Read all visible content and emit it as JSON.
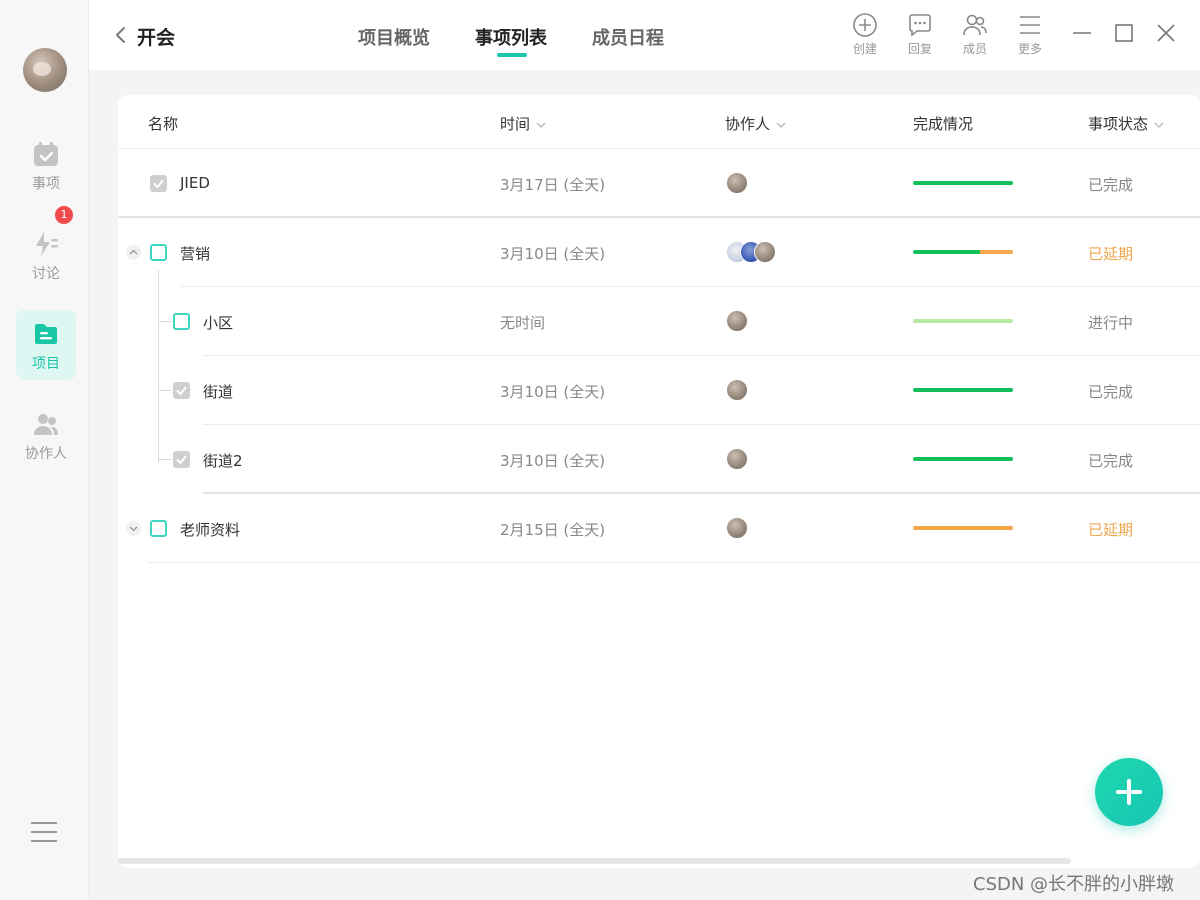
{
  "sidebar": {
    "items": [
      {
        "label": "事项",
        "icon": "calendar-check-icon"
      },
      {
        "label": "讨论",
        "icon": "lightning-icon",
        "badge": "1"
      },
      {
        "label": "项目",
        "icon": "folder-icon",
        "active": true
      },
      {
        "label": "协作人",
        "icon": "people-icon"
      }
    ],
    "menu_icon": "hamburger-menu-icon"
  },
  "header": {
    "title": "开会",
    "tabs": [
      {
        "label": "项目概览"
      },
      {
        "label": "事项列表",
        "active": true
      },
      {
        "label": "成员日程"
      }
    ],
    "tools": [
      {
        "label": "创建",
        "icon": "plus-circle-icon"
      },
      {
        "label": "回复",
        "icon": "chat-bubble-icon"
      },
      {
        "label": "成员",
        "icon": "members-icon"
      },
      {
        "label": "更多",
        "icon": "more-menu-icon"
      }
    ]
  },
  "table": {
    "columns": [
      "名称",
      "时间",
      "协作人",
      "完成情况",
      "事项状态"
    ],
    "rows": [
      {
        "name": "JIED",
        "time": "3月17日 (全天)",
        "status": "已完成",
        "checked": true,
        "level": 0,
        "progress": [
          {
            "fraction": 1.0,
            "color": "#12c05a"
          }
        ]
      },
      {
        "name": "营销",
        "time": "3月10日 (全天)",
        "status": "已延期",
        "checked": false,
        "level": 0,
        "expanded": true,
        "progress": [
          {
            "fraction": 0.67,
            "color": "#12c05a"
          },
          {
            "fraction": 0.33,
            "color": "#f5a84b"
          }
        ]
      },
      {
        "name": "小区",
        "time": "无时间",
        "status": "进行中",
        "checked": false,
        "level": 1,
        "progress": [
          {
            "fraction": 1.0,
            "color": "#b7e8a0"
          }
        ]
      },
      {
        "name": "街道",
        "time": "3月10日 (全天)",
        "status": "已完成",
        "checked": true,
        "level": 1,
        "progress": [
          {
            "fraction": 1.0,
            "color": "#12c05a"
          }
        ]
      },
      {
        "name": "街道2",
        "time": "3月10日 (全天)",
        "status": "已完成",
        "checked": true,
        "level": 1,
        "progress": [
          {
            "fraction": 1.0,
            "color": "#12c05a"
          }
        ]
      },
      {
        "name": "老师资料",
        "time": "2月15日 (全天)",
        "status": "已延期",
        "checked": false,
        "level": 0,
        "expanded": false,
        "progress": [
          {
            "fraction": 1.0,
            "color": "#f5a84b"
          }
        ]
      }
    ]
  },
  "colors": {
    "accent": "#19c7a6",
    "done": "#12c05a",
    "late": "#f5a84b",
    "badge": "#f04b4b"
  },
  "watermark": "CSDN @长不胖的小胖墩"
}
